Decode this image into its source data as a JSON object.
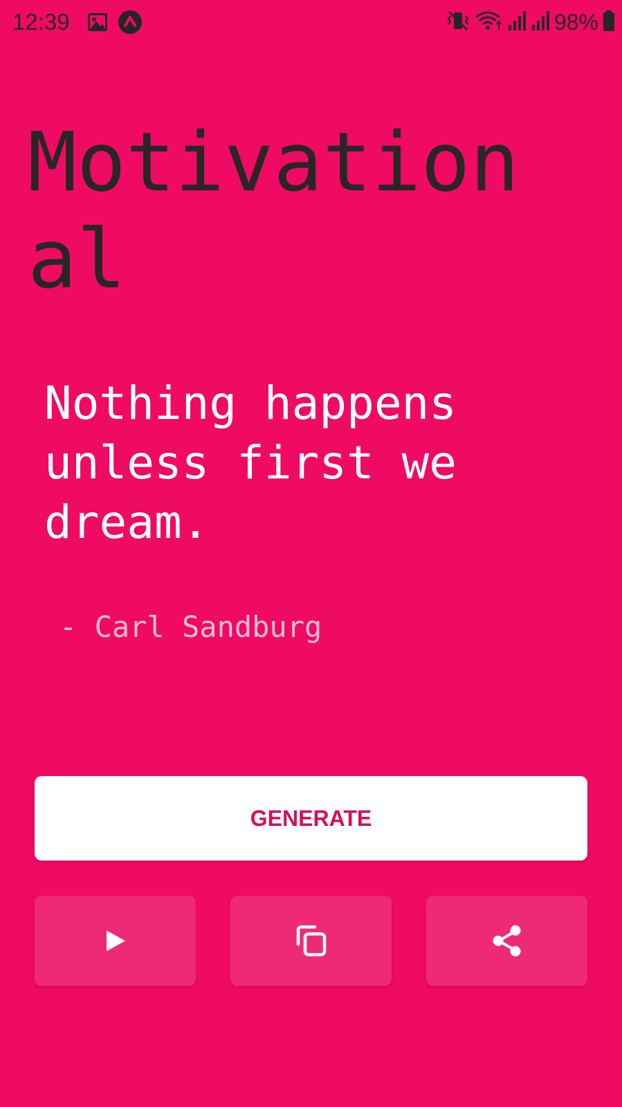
{
  "status_bar": {
    "time": "12:39",
    "battery": "98%",
    "left_icons": [
      "gallery-icon",
      "app-notification-icon"
    ],
    "right_icons": [
      "vibrate-icon",
      "wifi-icon",
      "signal-icon",
      "signal-icon-2",
      "battery-icon"
    ]
  },
  "main": {
    "category": "Motivational",
    "quote": "Nothing happens unless first we dream.",
    "author": "- Carl Sandburg"
  },
  "actions": {
    "generate_label": "GENERATE",
    "icons": [
      "play-icon",
      "copy-icon",
      "share-icon"
    ]
  },
  "colors": {
    "background": "#ef0a64",
    "button_text": "#d4105c",
    "action_button_bg": "#ee2a78"
  }
}
